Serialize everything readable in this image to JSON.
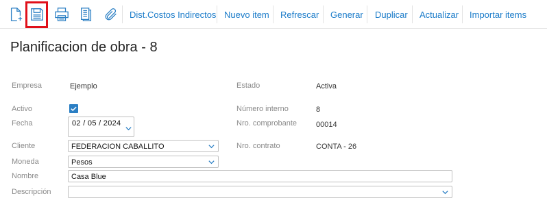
{
  "toolbar": {
    "icons": [
      "new-document-icon",
      "save-icon",
      "print-icon",
      "report-icon",
      "attachment-icon"
    ],
    "buttons": [
      "Dist.Costos Indirectos",
      "Nuevo item",
      "Refrescar",
      "Generar",
      "Duplicar",
      "Actualizar",
      "Importar items"
    ],
    "accent_color": "#1a7bc9",
    "highlight_color": "#e0101a"
  },
  "page": {
    "title": "Planificacion de obra - 8"
  },
  "form": {
    "empresa": {
      "label": "Empresa",
      "value": "Ejemplo"
    },
    "estado": {
      "label": "Estado",
      "value": "Activa"
    },
    "activo": {
      "label": "Activo",
      "checked": true
    },
    "numero_interno": {
      "label": "Número interno",
      "value": "8"
    },
    "fecha": {
      "label": "Fecha",
      "value": "02 / 05 /  2024"
    },
    "nro_comprobante": {
      "label": "Nro. comprobante",
      "value": "00014"
    },
    "cliente": {
      "label": "Cliente",
      "value": "FEDERACION CABALLITO"
    },
    "nro_contrato": {
      "label": "Nro. contrato",
      "value": "CONTA - 26"
    },
    "moneda": {
      "label": "Moneda",
      "value": "Pesos"
    },
    "nombre": {
      "label": "Nombre",
      "value": "Casa Blue"
    },
    "descripcion": {
      "label": "Descripción",
      "value": ""
    }
  }
}
